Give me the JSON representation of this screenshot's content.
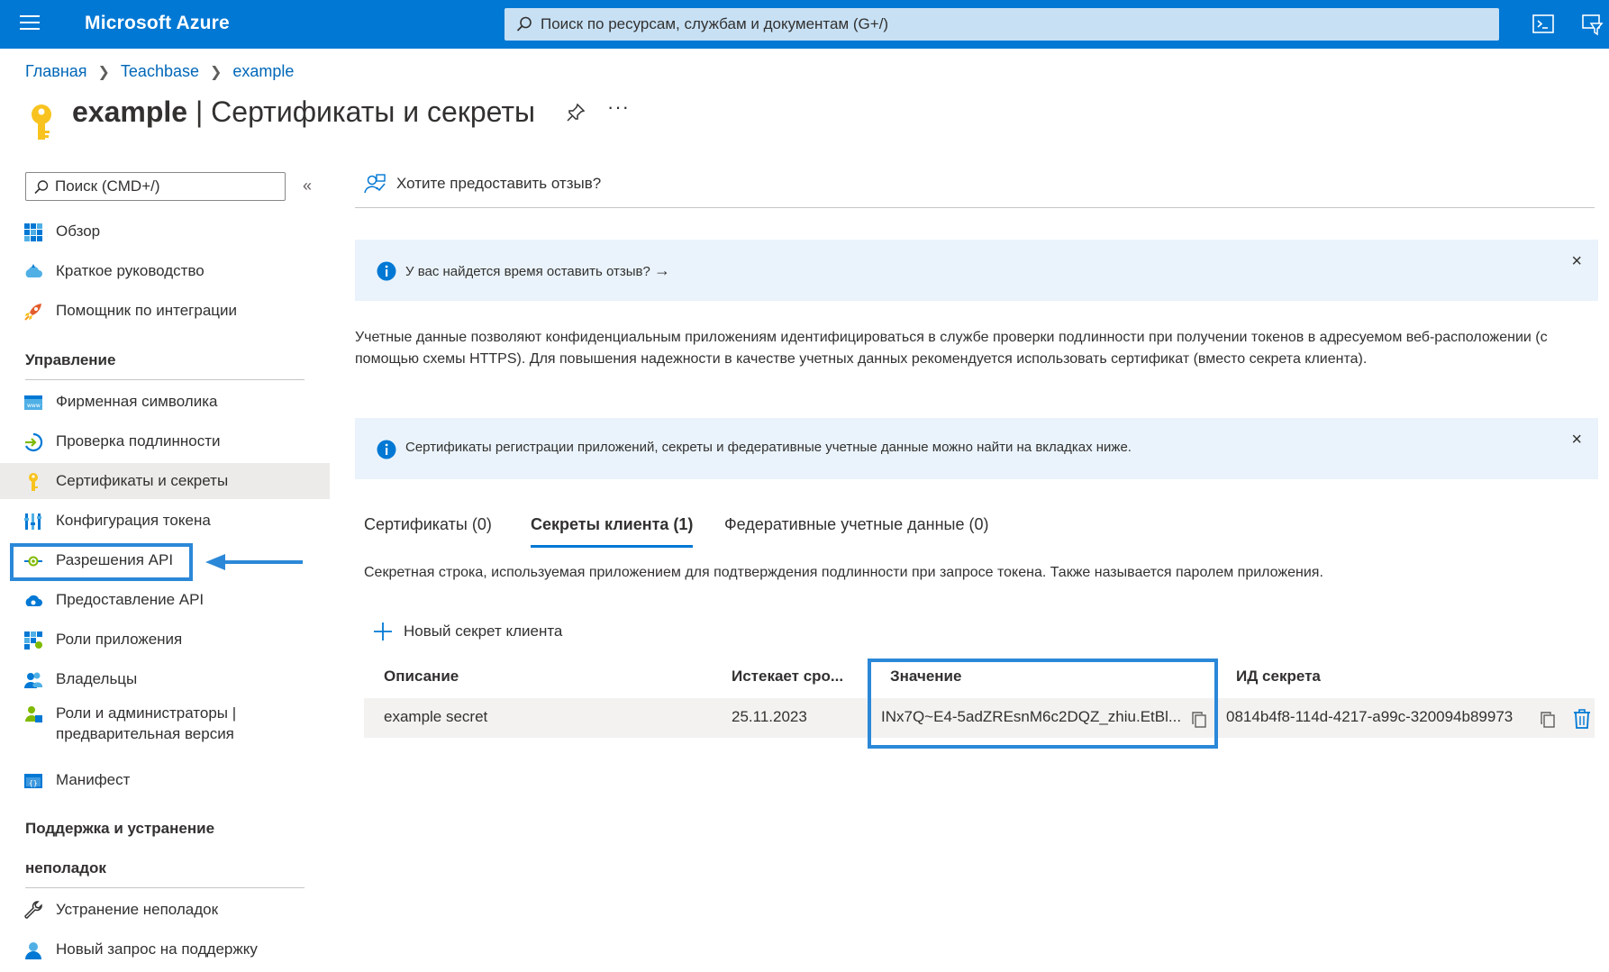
{
  "topbar": {
    "brand": "Microsoft Azure",
    "search_placeholder": "Поиск по ресурсам, службам и документам (G+/)"
  },
  "breadcrumb": [
    "Главная",
    "Teachbase",
    "example"
  ],
  "title": {
    "app": "example",
    "separator": " | ",
    "section": "Сертификаты и секреты",
    "more": "···"
  },
  "sidebar": {
    "search_placeholder": "Поиск (CMD+/)",
    "collapse": "«",
    "top_items": [
      {
        "label": "Обзор",
        "icon": "overview-grid-icon"
      },
      {
        "label": "Краткое руководство",
        "icon": "quickstart-cloud-icon"
      },
      {
        "label": "Помощник по интеграции",
        "icon": "rocket-icon"
      }
    ],
    "section_manage": "Управление",
    "manage_items": [
      {
        "label": "Фирменная символика",
        "icon": "branding-www-icon"
      },
      {
        "label": "Проверка подлинности",
        "icon": "authentication-icon"
      },
      {
        "label": "Сертификаты и секреты",
        "icon": "key-icon"
      },
      {
        "label": "Конфигурация токена",
        "icon": "token-bars-icon"
      },
      {
        "label": "Разрешения API",
        "icon": "api-permissions-icon"
      },
      {
        "label": "Предоставление API",
        "icon": "expose-api-cloud-icon"
      },
      {
        "label": "Роли приложения",
        "icon": "app-roles-grid-icon"
      },
      {
        "label": "Владельцы",
        "icon": "owners-people-icon"
      },
      {
        "label": "Роли и администраторы |",
        "label2": "предварительная версия",
        "icon": "roles-admins-icon"
      },
      {
        "label": "Манифест",
        "icon": "manifest-icon"
      }
    ],
    "section_support_1": "Поддержка и устранение",
    "section_support_2": "неполадок",
    "support_items": [
      {
        "label": "Устранение неполадок",
        "icon": "wrench-icon"
      },
      {
        "label": "Новый запрос на поддержку",
        "icon": "support-person-icon"
      }
    ]
  },
  "main": {
    "feedback": "Хотите предоставить отзыв?",
    "banner1": "У вас найдется время оставить отзыв?",
    "banner_arrow": "→",
    "close": "×",
    "description": "Учетные данные позволяют конфиденциальным приложениям идентифицироваться в службе проверки подлинности при получении токенов в адресуемом веб-расположении (с помощью схемы HTTPS). Для повышения надежности в качестве учетных данных рекомендуется использовать сертификат (вместо секрета клиента).",
    "banner2": "Сертификаты регистрации приложений, секреты и федеративные учетные данные можно найти на вкладках ниже.",
    "tabs": [
      {
        "label": "Сертификаты (0)",
        "active": false
      },
      {
        "label": "Секреты клиента (1)",
        "active": true
      },
      {
        "label": "Федеративные учетные данные (0)",
        "active": false
      }
    ],
    "tab_description": "Секретная строка, используемая приложением для подтверждения подлинности при запросе токена. Также называется паролем приложения.",
    "new_secret": "Новый секрет клиента",
    "table": {
      "headers": [
        "Описание",
        "Истекает сро...",
        "Значение",
        "ИД секрета"
      ],
      "rows": [
        {
          "description": "example secret",
          "expires": "25.11.2023",
          "value": "INx7Q~E4-5adZREsnM6c2DQZ_zhiu.EtBl...",
          "secret_id": "0814b4f8-114d-4217-a99c-320094b89973"
        }
      ]
    }
  },
  "colors": {
    "azure_blue": "#0078d4",
    "highlight": "#2b88d8",
    "link": "#0067b8",
    "banner_bg": "#eaf3fb"
  }
}
